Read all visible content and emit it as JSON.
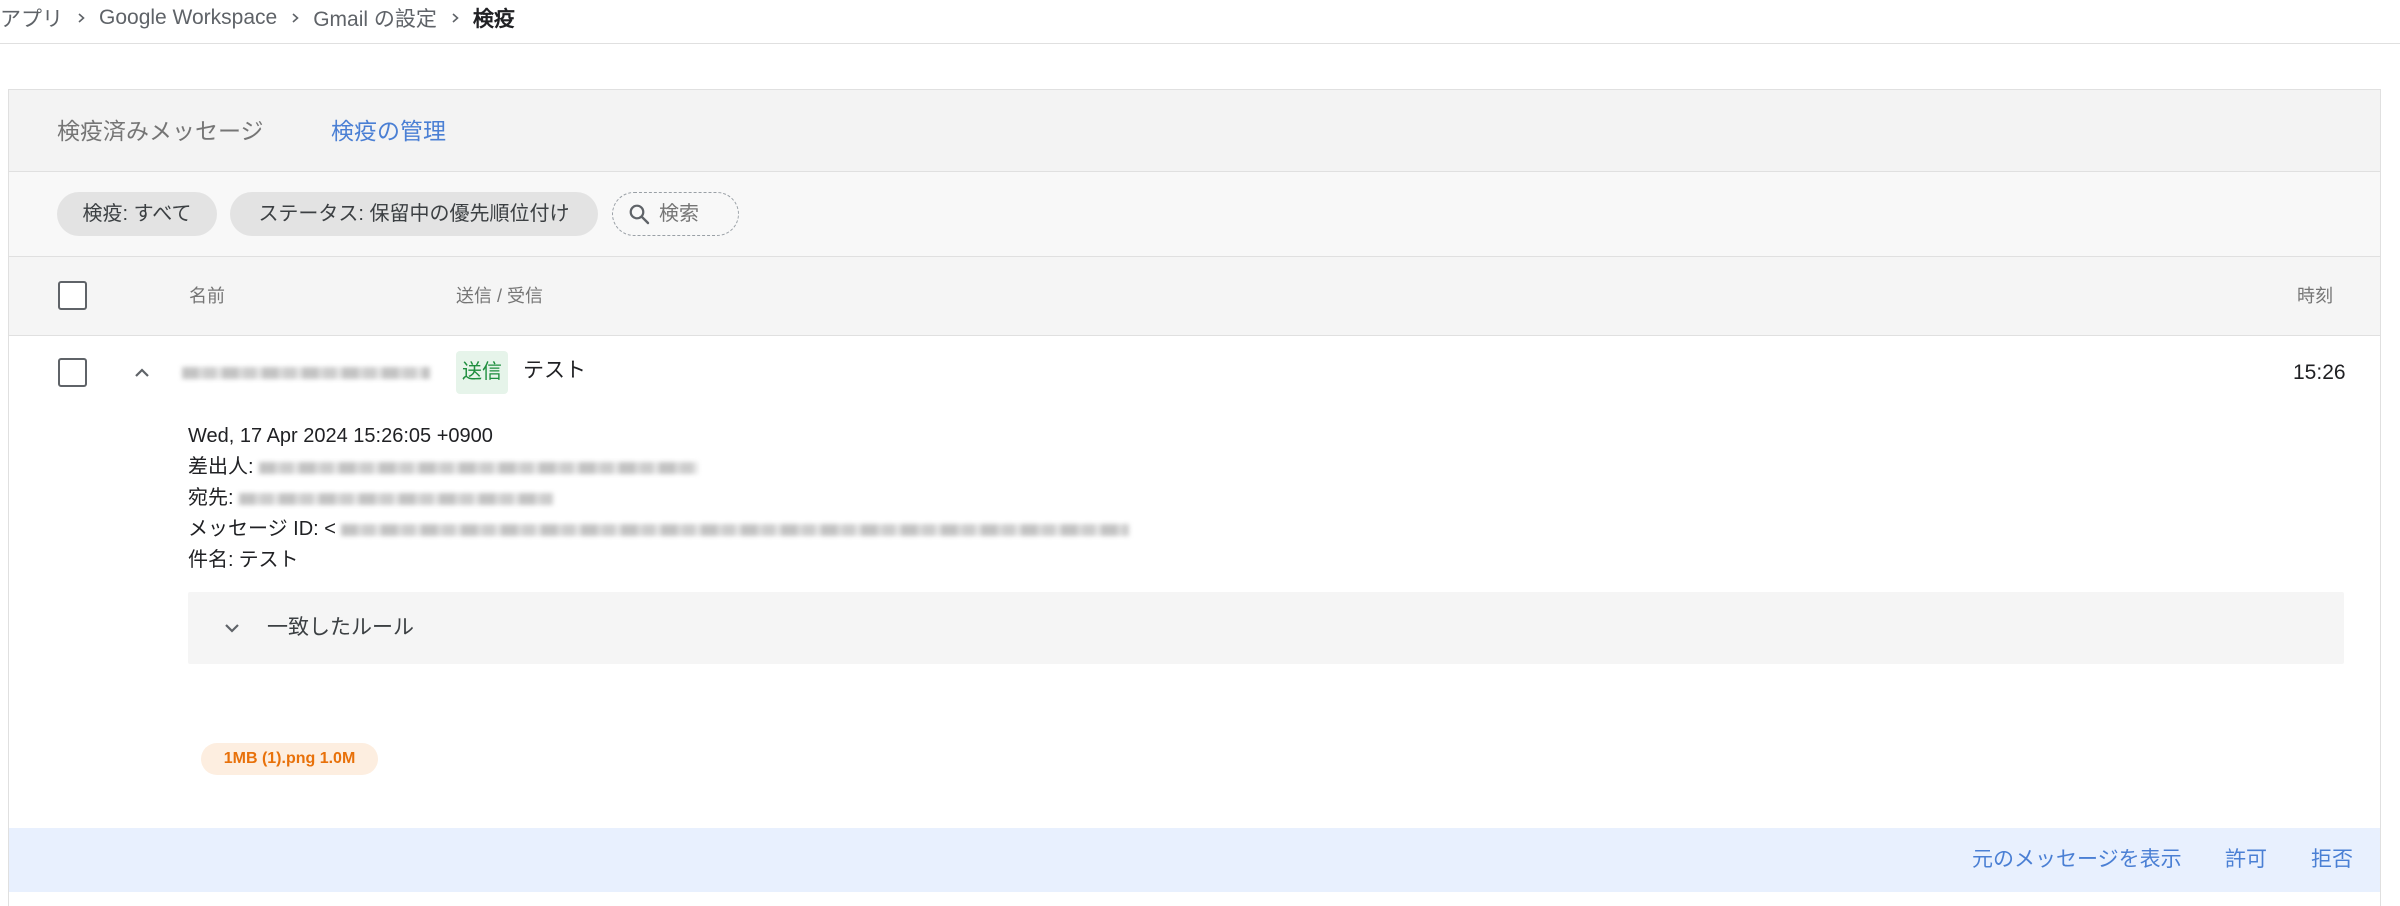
{
  "breadcrumb": [
    "アプリ",
    "Google Workspace",
    "Gmail の設定",
    "検疫"
  ],
  "tabs": {
    "messages": "検疫済みメッセージ",
    "manage": "検疫の管理"
  },
  "filters": {
    "quarantine_chip": "検疫: すべて",
    "status_chip": "ステータス: 保留中の優先順位付け",
    "search_placeholder": "検索"
  },
  "table": {
    "columns": {
      "name": "名前",
      "direction": "送信 / 受信",
      "time": "時刻"
    }
  },
  "message": {
    "direction_badge": "送信",
    "subject": "テスト",
    "time": "15:26",
    "details": {
      "date": "Wed, 17 Apr 2024 15:26:05 +0900",
      "from_label": "差出人:",
      "to_label": "宛先:",
      "message_id_label": "メッセージ ID: <",
      "subject_label": "件名:"
    },
    "matched_rules_label": "一致したルール",
    "attachment": "1MB (1).png 1.0M"
  },
  "actions": {
    "view_original": "元のメッセージを表示",
    "allow": "許可",
    "reject": "拒否"
  },
  "icons": {
    "breadcrumb_separator": "chevron-right-icon",
    "search": "search-icon",
    "collapse_row": "chevron-up-icon",
    "expand_rules": "chevron-down-icon",
    "checkbox": "checkbox-icon"
  },
  "colors": {
    "link_blue": "#4a7fd4",
    "sent_badge_bg": "#e6f4ea",
    "sent_badge_text": "#1e8e3e",
    "attachment_bg": "#fdeee0",
    "attachment_text": "#e8710a",
    "action_bar_bg": "#e8f0fe",
    "header_bg": "#f3f3f3",
    "chip_bg": "#e3e3e3"
  }
}
